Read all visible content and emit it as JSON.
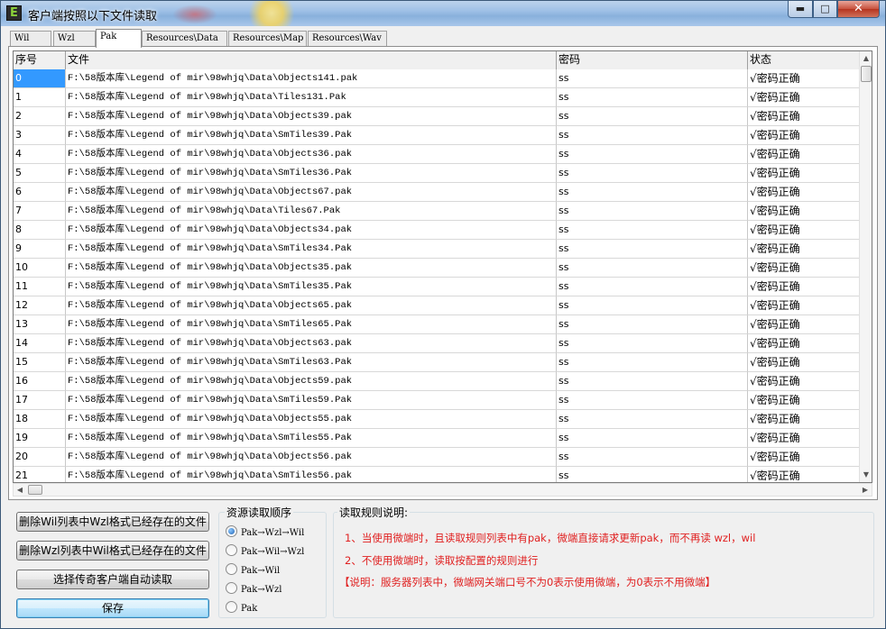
{
  "window": {
    "title": "客户端按照以下文件读取",
    "icon_letter": "E",
    "minimize_glyph": "▬",
    "maximize_glyph": "□",
    "close_glyph": "✕"
  },
  "tabs": [
    {
      "label": "Wil",
      "active": false
    },
    {
      "label": "Wzl",
      "active": false
    },
    {
      "label": "Pak",
      "active": true
    },
    {
      "label": "Resources\\Data",
      "active": false
    },
    {
      "label": "Resources\\Map",
      "active": false
    },
    {
      "label": "Resources\\Wav",
      "active": false
    }
  ],
  "grid": {
    "columns": [
      "序号",
      "文件",
      "密码",
      "状态"
    ],
    "rows": [
      {
        "index": "0",
        "file": "F:\\58版本库\\Legend of mir\\98whjq\\Data\\Objects141.pak",
        "password": "ss",
        "status": "√密码正确"
      },
      {
        "index": "1",
        "file": "F:\\58版本库\\Legend of mir\\98whjq\\Data\\Tiles131.Pak",
        "password": "ss",
        "status": "√密码正确"
      },
      {
        "index": "2",
        "file": "F:\\58版本库\\Legend of mir\\98whjq\\Data\\Objects39.pak",
        "password": "ss",
        "status": "√密码正确"
      },
      {
        "index": "3",
        "file": "F:\\58版本库\\Legend of mir\\98whjq\\Data\\SmTiles39.Pak",
        "password": "ss",
        "status": "√密码正确"
      },
      {
        "index": "4",
        "file": "F:\\58版本库\\Legend of mir\\98whjq\\Data\\Objects36.pak",
        "password": "ss",
        "status": "√密码正确"
      },
      {
        "index": "5",
        "file": "F:\\58版本库\\Legend of mir\\98whjq\\Data\\SmTiles36.Pak",
        "password": "ss",
        "status": "√密码正确"
      },
      {
        "index": "6",
        "file": "F:\\58版本库\\Legend of mir\\98whjq\\Data\\Objects67.pak",
        "password": "ss",
        "status": "√密码正确"
      },
      {
        "index": "7",
        "file": "F:\\58版本库\\Legend of mir\\98whjq\\Data\\Tiles67.Pak",
        "password": "ss",
        "status": "√密码正确"
      },
      {
        "index": "8",
        "file": "F:\\58版本库\\Legend of mir\\98whjq\\Data\\Objects34.pak",
        "password": "ss",
        "status": "√密码正确"
      },
      {
        "index": "9",
        "file": "F:\\58版本库\\Legend of mir\\98whjq\\Data\\SmTiles34.Pak",
        "password": "ss",
        "status": "√密码正确"
      },
      {
        "index": "10",
        "file": "F:\\58版本库\\Legend of mir\\98whjq\\Data\\Objects35.pak",
        "password": "ss",
        "status": "√密码正确"
      },
      {
        "index": "11",
        "file": "F:\\58版本库\\Legend of mir\\98whjq\\Data\\SmTiles35.Pak",
        "password": "ss",
        "status": "√密码正确"
      },
      {
        "index": "12",
        "file": "F:\\58版本库\\Legend of mir\\98whjq\\Data\\Objects65.pak",
        "password": "ss",
        "status": "√密码正确"
      },
      {
        "index": "13",
        "file": "F:\\58版本库\\Legend of mir\\98whjq\\Data\\SmTiles65.Pak",
        "password": "ss",
        "status": "√密码正确"
      },
      {
        "index": "14",
        "file": "F:\\58版本库\\Legend of mir\\98whjq\\Data\\Objects63.pak",
        "password": "ss",
        "status": "√密码正确"
      },
      {
        "index": "15",
        "file": "F:\\58版本库\\Legend of mir\\98whjq\\Data\\SmTiles63.Pak",
        "password": "ss",
        "status": "√密码正确"
      },
      {
        "index": "16",
        "file": "F:\\58版本库\\Legend of mir\\98whjq\\Data\\Objects59.pak",
        "password": "ss",
        "status": "√密码正确"
      },
      {
        "index": "17",
        "file": "F:\\58版本库\\Legend of mir\\98whjq\\Data\\SmTiles59.Pak",
        "password": "ss",
        "status": "√密码正确"
      },
      {
        "index": "18",
        "file": "F:\\58版本库\\Legend of mir\\98whjq\\Data\\Objects55.pak",
        "password": "ss",
        "status": "√密码正确"
      },
      {
        "index": "19",
        "file": "F:\\58版本库\\Legend of mir\\98whjq\\Data\\SmTiles55.Pak",
        "password": "ss",
        "status": "√密码正确"
      },
      {
        "index": "20",
        "file": "F:\\58版本库\\Legend of mir\\98whjq\\Data\\Objects56.pak",
        "password": "ss",
        "status": "√密码正确"
      },
      {
        "index": "21",
        "file": "F:\\58版本库\\Legend of mir\\98whjq\\Data\\SmTiles56.pak",
        "password": "ss",
        "status": "√密码正确"
      }
    ],
    "selected_row": "0"
  },
  "actions": {
    "delete_wil_label": "删除Wil列表中Wzl格式已经存在的文件",
    "delete_wzl_label": "删除Wzl列表中Wil格式已经存在的文件",
    "auto_read_label": "选择传奇客户端自动读取",
    "save_label": "保存"
  },
  "order": {
    "title": "资源读取顺序",
    "options": [
      {
        "label": "Pak→Wzl→Wil",
        "selected": true
      },
      {
        "label": "Pak→Wil→Wzl",
        "selected": false
      },
      {
        "label": "Pak→Wil",
        "selected": false
      },
      {
        "label": "Pak→Wzl",
        "selected": false
      },
      {
        "label": "Pak",
        "selected": false
      }
    ]
  },
  "rules": {
    "title": "读取规则说明:",
    "line1": "1、当使用微端时，且读取规则列表中有pak，微端直接请求更新pak，而不再读 wzl，wil",
    "line2": "2、不使用微端时，读取按配置的规则进行",
    "line3": "【说明：服务器列表中，微端网关端口号不为0表示使用微端，为0表示不用微端】",
    "text_color": "#e02020"
  },
  "colors": {
    "selection": "#3399ff",
    "primary_button": "#bee6fd"
  }
}
